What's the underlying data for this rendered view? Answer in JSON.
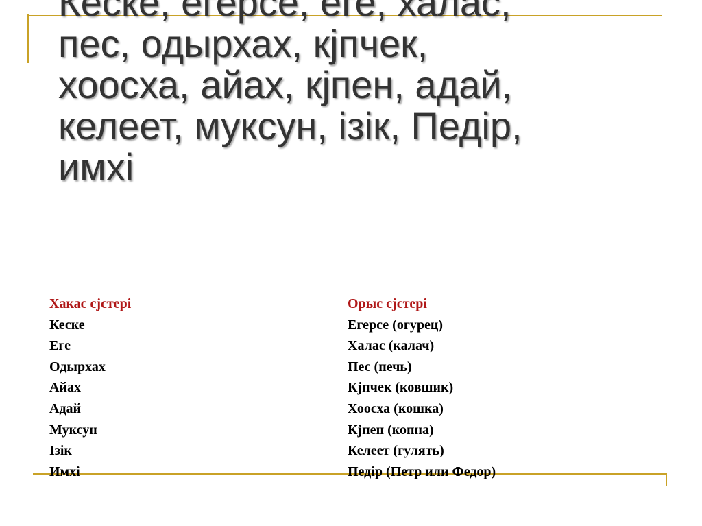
{
  "heading": {
    "lines": [
      "Кеске, егерсе, еге, халас,",
      "пес, одырхах, кјпчек,",
      "хоосха, айах, кјпен, адай,",
      "келеет, муксун, ізік, Педір,",
      "имхі"
    ]
  },
  "left_column": {
    "header": "Хакас сјстері",
    "items": [
      "Кеске",
      "Еге",
      "Одырхах",
      "Айах",
      "Адай",
      "Муксун",
      "Ізік",
      "Имхі"
    ]
  },
  "right_column": {
    "header": "Орыс сјстері",
    "items": [
      "Егерсе (огурец)",
      "Халас (калач)",
      "Пес (печь)",
      "Кјпчек (ковшик)",
      "Хоосха (кошка)",
      "Кјпен (копна)",
      "Келеет (гулять)",
      "Педір (Петр или Федор)"
    ]
  },
  "colors": {
    "accent_line": "#c9a227",
    "column_header": "#b01818",
    "heading_text": "#333333"
  }
}
